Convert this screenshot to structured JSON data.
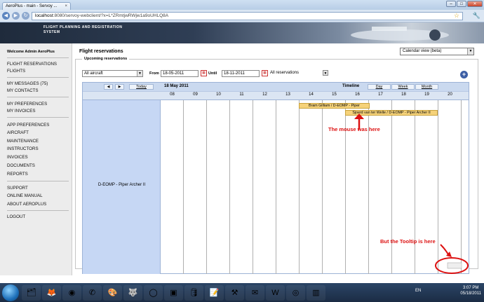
{
  "browser": {
    "tab_title": "AeroPlus - main - Servoy ...",
    "tab_close": "×",
    "url_host": "localhost",
    "url_rest": ":8080/servoy-webclient/?x=L*ZRmtjwRWjw1a9oUHLQ8A",
    "back": "◀",
    "forward": "▶",
    "reload": "↻",
    "star": "☆",
    "wrench": "🔧",
    "minimize": "–",
    "maximize": "□",
    "close": "✕"
  },
  "banner": {
    "subtitle": "FLIGHT PLANNING AND REGISTRATION SYSTEM"
  },
  "sidebar": {
    "welcome": "Welcome Admin AeroPlus",
    "items": [
      "FLIGHT RESERVATIONS",
      "FLIGHTS",
      "MY MESSAGES (75)",
      "MY CONTACTS",
      "MY PREFERENCES",
      "MY INVOICES",
      "APP PREFERENCES",
      "AIRCRAFT",
      "MAINTENANCE",
      "INSTRUCTORS",
      "INVOICES",
      "DOCUMENTS",
      "REPORTS",
      "SUPPORT",
      "ONLINE MANUAL",
      "ABOUT AEROPLUS",
      "LOGOUT"
    ]
  },
  "main": {
    "title": "Flight reservations",
    "view_select": "Calendar view (beta)",
    "group_label": "Upcoming reservations",
    "aircraft_filter": "All aircraft",
    "from_label": "From",
    "from_date": "18-05-2011",
    "until_label": "Until",
    "until_date": "18-11-2011",
    "reservation_filter": "All reservations",
    "add": "+"
  },
  "schedule": {
    "prev": "◀",
    "next": "▶",
    "today": "Today",
    "date": "18 May 2011",
    "timeline": "Timeline",
    "day": "Day",
    "week": "Week",
    "month": "Month",
    "hours": [
      "08",
      "09",
      "10",
      "11",
      "12",
      "13",
      "14",
      "15",
      "16",
      "17",
      "18",
      "19",
      "20"
    ],
    "resource": "D-EOMP - Piper Archer II",
    "events": [
      {
        "text": "Bram Gilliam / D-EOMP - Piper"
      },
      {
        "text": "Sjoerd van ter Welle / D-EOMP - Piper Archer II"
      }
    ]
  },
  "annotations": {
    "mouse": "The mouse was here",
    "tooltip": "But the Tooltip is here"
  },
  "taskbar": {
    "lang": "EN",
    "time": "3:07 PM",
    "date": "05/18/2011"
  },
  "colors": {
    "annotation": "#dd1111",
    "event": "#f5d27a",
    "resource": "#c6d7f4"
  }
}
